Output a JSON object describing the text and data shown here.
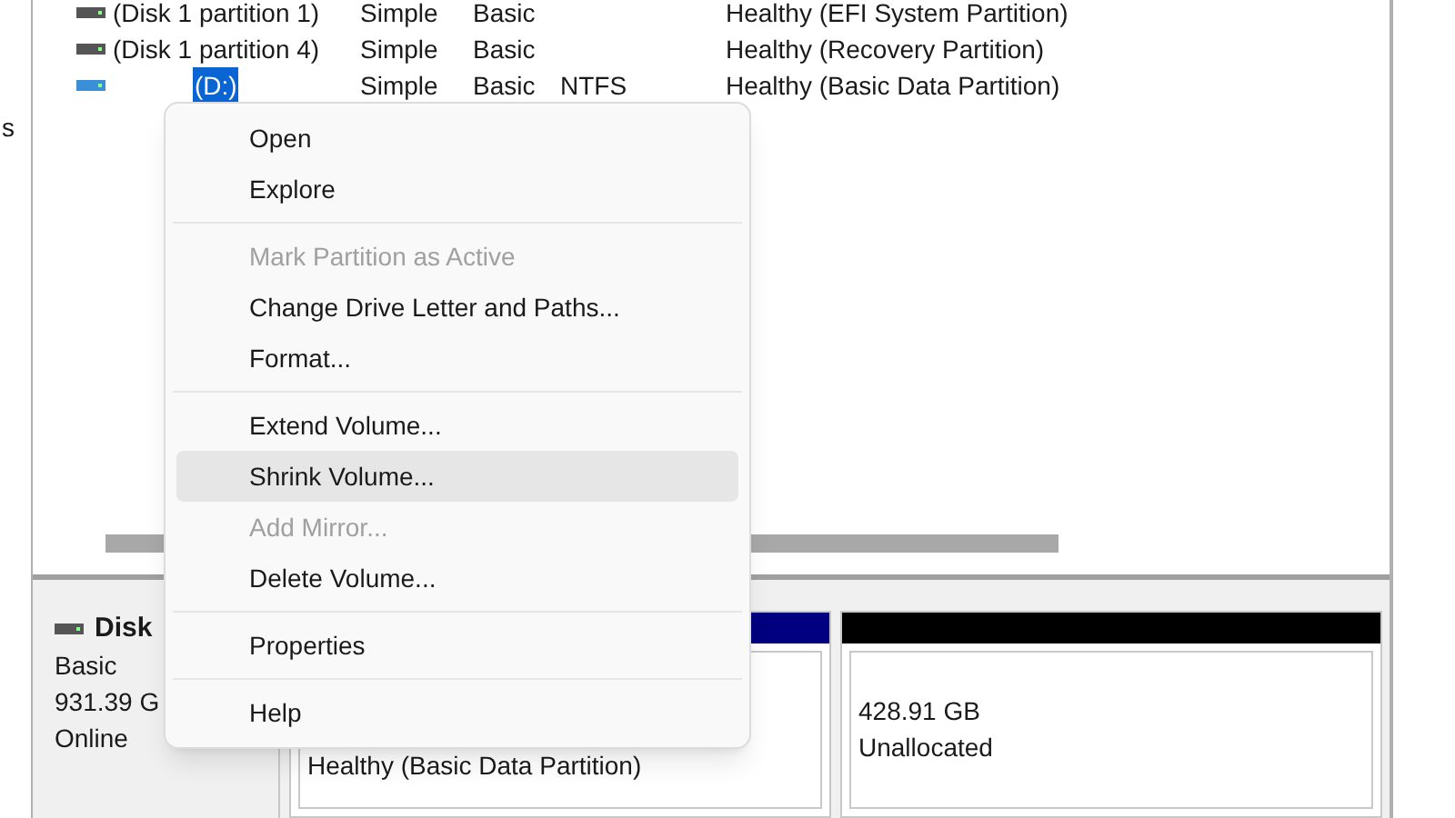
{
  "edge_text": "s",
  "volumes": [
    {
      "name": "(Disk 1 partition 1)",
      "layout": "Simple",
      "type": "Basic",
      "status": "Healthy (EFI System Partition)",
      "selected": false
    },
    {
      "name": "(Disk 1 partition 4)",
      "layout": "Simple",
      "type": "Basic",
      "status": "Healthy (Recovery Partition)",
      "selected": false
    },
    {
      "name": "(D:)",
      "layout": "Simple",
      "type": "Basic",
      "file_system": "NTFS",
      "status": "Healthy (Basic Data Partition)",
      "selected": true
    }
  ],
  "disk": {
    "title": "Disk",
    "type": "Basic",
    "size": "931.39 G",
    "status": "Online"
  },
  "partitions": [
    {
      "color": "#000080",
      "lines": [
        "Healthy (Basic Data Partition)"
      ]
    },
    {
      "color": "#000000",
      "lines": [
        "428.91 GB",
        "Unallocated"
      ]
    }
  ],
  "context_menu": [
    {
      "kind": "item",
      "label": "Open",
      "disabled": false,
      "selected": false
    },
    {
      "kind": "item",
      "label": "Explore",
      "disabled": false,
      "selected": false
    },
    {
      "kind": "separator"
    },
    {
      "kind": "item",
      "label": "Mark Partition as Active",
      "disabled": true,
      "selected": false
    },
    {
      "kind": "item",
      "label": "Change Drive Letter and Paths...",
      "disabled": false,
      "selected": false
    },
    {
      "kind": "item",
      "label": "Format...",
      "disabled": false,
      "selected": false
    },
    {
      "kind": "separator"
    },
    {
      "kind": "item",
      "label": "Extend Volume...",
      "disabled": false,
      "selected": false
    },
    {
      "kind": "item",
      "label": "Shrink Volume...",
      "disabled": false,
      "selected": true
    },
    {
      "kind": "item",
      "label": "Add Mirror...",
      "disabled": true,
      "selected": false
    },
    {
      "kind": "item",
      "label": "Delete Volume...",
      "disabled": false,
      "selected": false
    },
    {
      "kind": "separator"
    },
    {
      "kind": "item",
      "label": "Properties",
      "disabled": false,
      "selected": false
    },
    {
      "kind": "separator"
    },
    {
      "kind": "item",
      "label": "Help",
      "disabled": false,
      "selected": false
    }
  ]
}
